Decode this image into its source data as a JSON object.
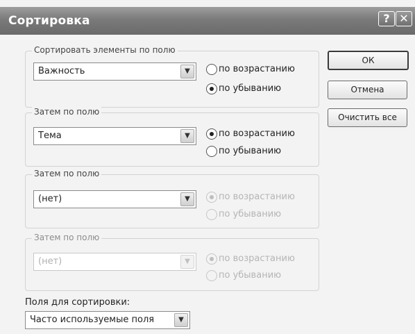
{
  "window": {
    "title": "Сортировка",
    "help_glyph": "?",
    "close_glyph": "✕"
  },
  "sort_groups": [
    {
      "label": "Сортировать элементы по полю",
      "field_value": "Важность",
      "ascending_label": "по возрастанию",
      "descending_label": "по убыванию",
      "selected": "descending",
      "enabled": true
    },
    {
      "label": "Затем по полю",
      "field_value": "Тема",
      "ascending_label": "по возрастанию",
      "descending_label": "по убыванию",
      "selected": "ascending",
      "enabled": true
    },
    {
      "label": "Затем по полю",
      "field_value": "(нет)",
      "ascending_label": "по возрастанию",
      "descending_label": "по убыванию",
      "selected": "ascending",
      "enabled": true,
      "radios_enabled": false
    },
    {
      "label": "Затем по полю",
      "field_value": "(нет)",
      "ascending_label": "по возрастанию",
      "descending_label": "по убыванию",
      "selected": "ascending",
      "enabled": false
    }
  ],
  "buttons": {
    "ok": "ОК",
    "cancel": "Отмена",
    "clear_all": "Очистить все"
  },
  "fields_for_sorting": {
    "label": "Поля для сортировки:",
    "value": "Часто используемые поля"
  },
  "icons": {
    "dropdown_arrow": "chevron-down-icon",
    "dropdown_glyph": "▼"
  }
}
